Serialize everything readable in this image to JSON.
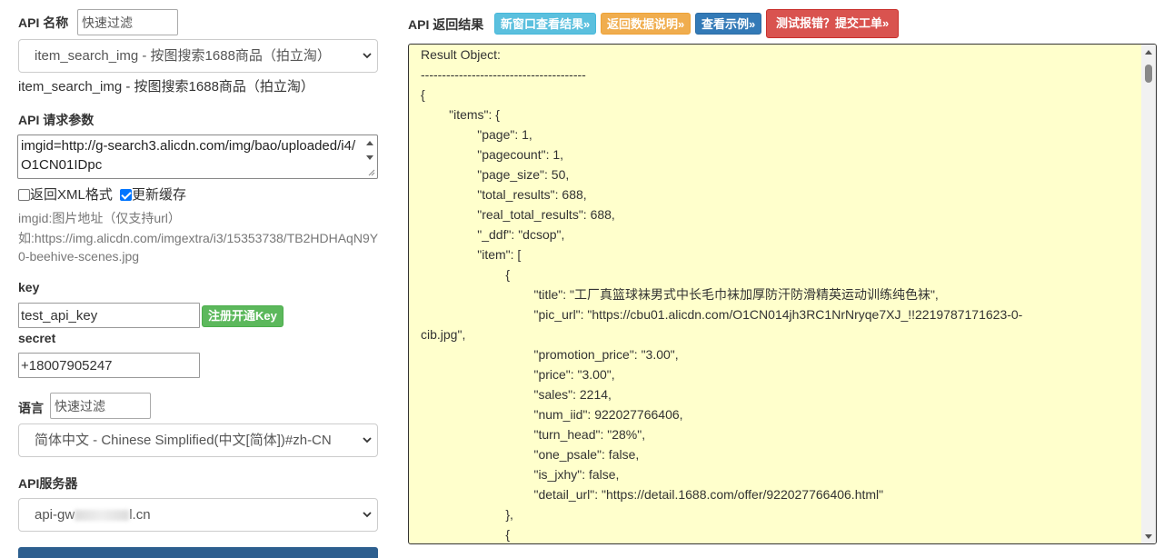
{
  "api_name": {
    "label": "API 名称",
    "filter_placeholder": "快速过滤"
  },
  "api_select": {
    "value": "item_search_img - 按图搜索1688商品（拍立淘）",
    "caption": "item_search_img - 按图搜索1688商品（拍立淘）"
  },
  "params": {
    "label": "API 请求参数",
    "textarea_value": "imgid=http://g-search3.alicdn.com/img/bao/uploaded/i4/O1CN01IDpc",
    "xml_label": "返回XML格式",
    "cache_label": "更新缓存",
    "hint1": "imgid:图片地址（仅支持url）",
    "hint2": "如:https://img.alicdn.com/imgextra/i3/15353738/TB2HDHAqN9Y",
    "hint3": "0-beehive-scenes.jpg"
  },
  "key": {
    "label": "key",
    "value": "test_api_key",
    "register_label": "注册开通Key"
  },
  "secret": {
    "label": "secret",
    "value": "+18007905247"
  },
  "language": {
    "label": "语言",
    "filter_placeholder": "快速过滤",
    "value": "简体中文 - Chinese Simplified(中文[简体])#zh-CN"
  },
  "server": {
    "label": "API服务器",
    "value_prefix": "api-gw",
    "value_suffix": "l.cn"
  },
  "result": {
    "label": "API 返回结果",
    "btn_new_window": "新窗口查看结果»",
    "btn_doc": "返回数据说明»",
    "btn_example": "查看示例»",
    "btn_report": "测试报错？提交工单»",
    "text": "Result Object:\n---------------------------------------\n{\n        \"items\": {\n                \"page\": 1,\n                \"pagecount\": 1,\n                \"page_size\": 50,\n                \"total_results\": 688,\n                \"real_total_results\": 688,\n                \"_ddf\": \"dcsop\",\n                \"item\": [\n                        {\n                                \"title\": \"工厂真篮球袜男式中长毛巾袜加厚防汗防滑精英运动训练纯色袜\",\n                                \"pic_url\": \"https://cbu01.alicdn.com/O1CN014jh3RC1NrNryqe7XJ_!!2219787171623-0-\ncib.jpg\",\n                                \"promotion_price\": \"3.00\",\n                                \"price\": \"3.00\",\n                                \"sales\": 2214,\n                                \"num_iid\": 922027766406,\n                                \"turn_head\": \"28%\",\n                                \"one_psale\": false,\n                                \"is_jxhy\": false,\n                                \"detail_url\": \"https://detail.1688.com/offer/922027766406.html\"\n                        },\n                        {"
  },
  "colors": {
    "panel_bg": "#ffffcc",
    "btn_info": "#5bc0de",
    "btn_warning": "#f0ad4e",
    "btn_primary": "#337ab7",
    "btn_danger": "#d9534f",
    "btn_success": "#5cb85c"
  }
}
